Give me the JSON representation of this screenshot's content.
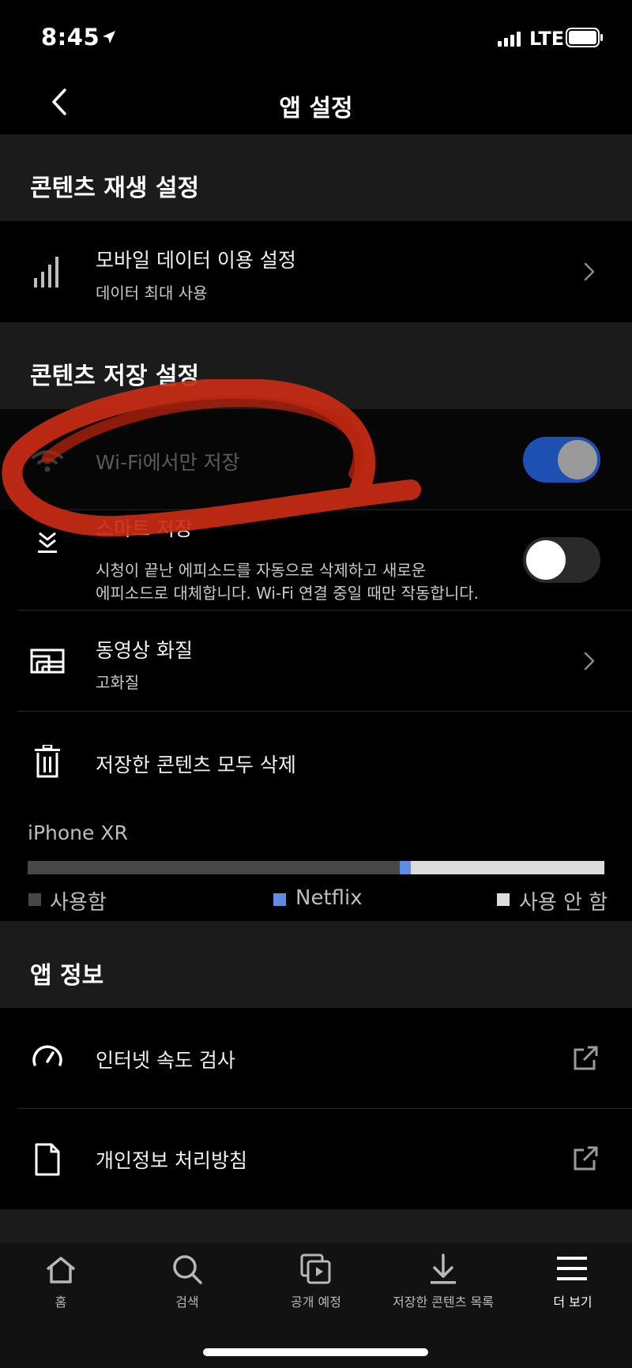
{
  "status_bar": {
    "time": "8:45",
    "carrier": "LTE",
    "icons": [
      "location-arrow-icon",
      "signal-icon",
      "battery-icon"
    ]
  },
  "header": {
    "title": "앱 설정",
    "icons": [
      "back-chevron-icon"
    ]
  },
  "sections": {
    "playback": {
      "title": "콘텐츠 재생 설정",
      "mobile_data": {
        "title": "모바일 데이터 이용 설정",
        "subtitle": "데이터 최대 사용",
        "icon": "signal-bars-icon"
      }
    },
    "downloads": {
      "title": "콘텐츠 저장 설정",
      "wifi_only": {
        "title": "Wi-Fi에서만 저장",
        "icon": "wifi-icon",
        "enabled": true
      },
      "smart_downloads": {
        "title": "스마트 저장",
        "desc_line1": "시청이 끝난 에피소드를 자동으로 삭제하고 새로운",
        "desc_line2": "에피소드로 대체합니다. Wi-Fi 연결 중일 때만 작동합니다.",
        "icon": "smart-download-icon",
        "enabled": false
      },
      "video_quality": {
        "title": "동영상 화질",
        "subtitle": "고화질",
        "icon": "video-quality-icon"
      },
      "delete_all": {
        "title": "저장한 콘텐츠 모두 삭제",
        "icon": "trash-icon"
      },
      "storage": {
        "device": "iPhone XR",
        "used_fraction": 0.645,
        "netflix_fraction": 0.02,
        "legend": {
          "used": "사용함",
          "netflix": "Netflix",
          "free": "사용 안 함"
        },
        "colors": {
          "used": "#474747",
          "netflix": "#5f8de4",
          "free": "#dcdcdc"
        }
      }
    },
    "about": {
      "title": "앱 정보",
      "speed_test": {
        "title": "인터넷 속도 검사",
        "icon": "speedometer-icon",
        "action_icon": "external-link-icon"
      },
      "privacy": {
        "title": "개인정보 처리방침",
        "icon": "document-icon",
        "action_icon": "external-link-icon"
      }
    }
  },
  "tab_bar": {
    "tabs": [
      {
        "label": "홈",
        "icon": "home-icon"
      },
      {
        "label": "검색",
        "icon": "search-icon"
      },
      {
        "label": "공개 예정",
        "icon": "coming-soon-icon"
      },
      {
        "label": "저장한 콘텐츠 목록",
        "icon": "download-icon"
      },
      {
        "label": "더 보기",
        "icon": "menu-icon"
      }
    ]
  },
  "annotation": {
    "type": "red-scribble-circle",
    "color": "#c82b14"
  },
  "colors": {
    "toggle_on": "#1e4fb2",
    "toggle_off": "#2a2a2a",
    "background": "#000000",
    "section_header_bg": "#1b1b1b"
  }
}
